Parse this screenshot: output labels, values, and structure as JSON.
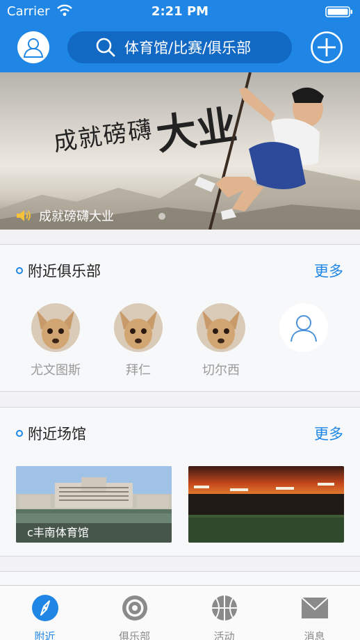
{
  "status_bar": {
    "carrier": "Carrier",
    "time": "2:21 PM"
  },
  "header": {
    "search_placeholder": "体育馆/比赛/俱乐部"
  },
  "banner": {
    "artwork_text": "成就磅礴大业",
    "caption": "成就磅礴大业"
  },
  "nearby_clubs": {
    "title": "附近俱乐部",
    "more": "更多",
    "clubs": [
      {
        "name": "尤文图斯"
      },
      {
        "name": "拜仁"
      },
      {
        "name": "切尔西"
      },
      {
        "name": ""
      }
    ]
  },
  "nearby_venues": {
    "title": "附近场馆",
    "more": "更多",
    "venues": [
      {
        "name": "c丰南体育馆"
      },
      {
        "name": ""
      }
    ]
  },
  "tabs": [
    {
      "label": "附近",
      "icon": "compass-icon",
      "active": true
    },
    {
      "label": "俱乐部",
      "icon": "target-icon",
      "active": false
    },
    {
      "label": "活动",
      "icon": "basketball-icon",
      "active": false
    },
    {
      "label": "消息",
      "icon": "envelope-icon",
      "active": false
    }
  ],
  "colors": {
    "accent": "#1f86e5",
    "search_bg": "#1269c4",
    "inactive": "#8a8a8a"
  }
}
